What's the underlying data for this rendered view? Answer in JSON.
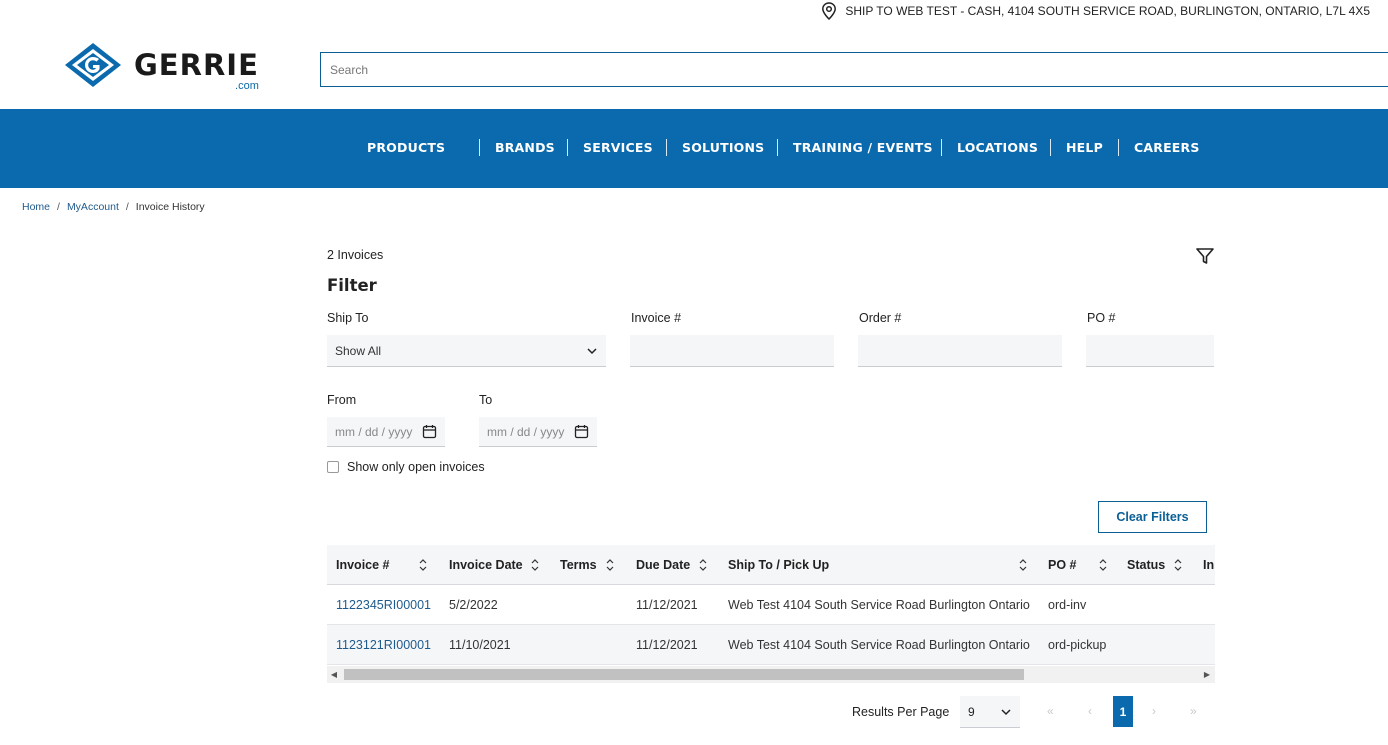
{
  "header": {
    "ship_to": "SHIP TO WEB TEST - CASH, 4104 SOUTH SERVICE ROAD, BURLINGTON, ONTARIO, L7L 4X5",
    "logo_word": "GERRIE",
    "logo_suffix": ".com",
    "search_placeholder": "Search"
  },
  "nav": {
    "items": [
      "PRODUCTS",
      "BRANDS",
      "SERVICES",
      "SOLUTIONS",
      "TRAINING / EVENTS",
      "LOCATIONS",
      "HELP",
      "CAREERS"
    ]
  },
  "breadcrumb": {
    "items": [
      "Home",
      "MyAccount",
      "Invoice History"
    ],
    "separator": "/"
  },
  "content": {
    "count": "2 Invoices",
    "filter_title": "Filter",
    "filters": {
      "ship_to_label": "Ship To",
      "ship_to_value": "Show All",
      "invoice_label": "Invoice #",
      "order_label": "Order #",
      "po_label": "PO #",
      "from_label": "From",
      "to_label": "To",
      "date_placeholder": "mm / dd / yyyy",
      "open_only_label": "Show only open invoices"
    },
    "clear_filters": "Clear Filters"
  },
  "table": {
    "columns": [
      "Invoice #",
      "Invoice Date",
      "Terms",
      "Due Date",
      "Ship To / Pick Up",
      "PO #",
      "Status",
      "In"
    ],
    "rows": [
      {
        "invoice": "1122345RI00001",
        "invoice_date": "5/2/2022",
        "terms": "",
        "due_date": "11/12/2021",
        "ship_to": "Web Test 4104 South Service Road Burlington Ontario",
        "po": "ord-inv",
        "status": ""
      },
      {
        "invoice": "1123121RI00001",
        "invoice_date": "11/10/2021",
        "terms": "",
        "due_date": "11/12/2021",
        "ship_to": "Web Test 4104 South Service Road Burlington Ontario",
        "po": "ord-pickup",
        "status": ""
      }
    ]
  },
  "pagination": {
    "results_per_page_label": "Results Per Page",
    "per_page_value": "9",
    "first": "«",
    "prev": "‹",
    "current_page": "1",
    "next": "›",
    "last": "»"
  },
  "colors": {
    "brand_blue": "#0a6aad",
    "link_blue": "#1f5a8c"
  }
}
